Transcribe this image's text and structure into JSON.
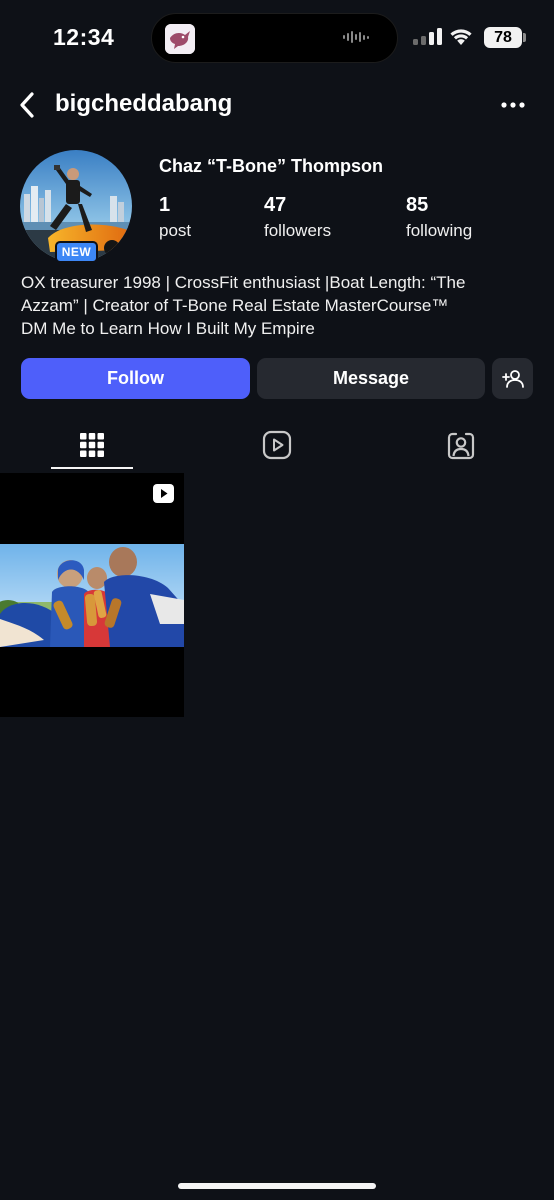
{
  "status_bar": {
    "time": "12:34",
    "battery": "78"
  },
  "header": {
    "username": "bigcheddabang",
    "back_icon": "chevron-left-icon",
    "more_icon": "ellipsis-icon"
  },
  "profile": {
    "display_name": "Chaz “T-Bone” Thompson",
    "new_badge": "NEW",
    "stats": [
      {
        "value": "1",
        "label": "post"
      },
      {
        "value": "47",
        "label": "followers"
      },
      {
        "value": "85",
        "label": "following"
      }
    ],
    "bio": [
      "OX treasurer 1998 | CrossFit enthusiast |Boat Length: “The",
      "Azzam” | Creator of T-Bone Real Estate MasterCourse™",
      "DM Me to Learn How I Built My Empire"
    ]
  },
  "actions": {
    "follow_label": "Follow",
    "message_label": "Message",
    "add_user_icon": "add-person-icon"
  },
  "tabs": [
    {
      "icon": "grid-icon",
      "selected": true
    },
    {
      "icon": "reels-icon",
      "selected": false
    },
    {
      "icon": "tagged-icon",
      "selected": false
    }
  ],
  "posts": [
    {
      "type": "reel",
      "icon": "reel-play-icon"
    }
  ],
  "colors": {
    "background": "#0e1117",
    "follow_button": "#4e5ffa",
    "secondary_button": "#262930",
    "new_badge": "#3d87f5"
  }
}
